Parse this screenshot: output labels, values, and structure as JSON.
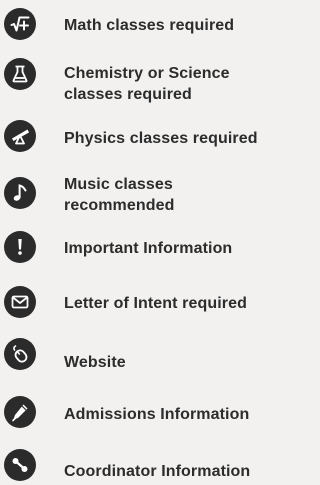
{
  "legend": {
    "items": [
      {
        "icon": "square-root-plus-icon",
        "label": "Math classes required"
      },
      {
        "icon": "flask-icon",
        "label": "Chemistry or Science classes required"
      },
      {
        "icon": "telescope-icon",
        "label": "Physics classes required"
      },
      {
        "icon": "music-note-icon",
        "label": "Music classes recommended"
      },
      {
        "icon": "exclamation-icon",
        "label": "Important Information"
      },
      {
        "icon": "envelope-icon",
        "label": "Letter of Intent required"
      },
      {
        "icon": "mouse-icon",
        "label": "Website"
      },
      {
        "icon": "pen-icon",
        "label": "Admissions Information"
      },
      {
        "icon": "share-link-icon",
        "label": "Coordinator Information"
      }
    ],
    "colors": {
      "badge": "#2b2b2b",
      "text": "#2c2c2c",
      "background": "#f2f1f0"
    }
  }
}
